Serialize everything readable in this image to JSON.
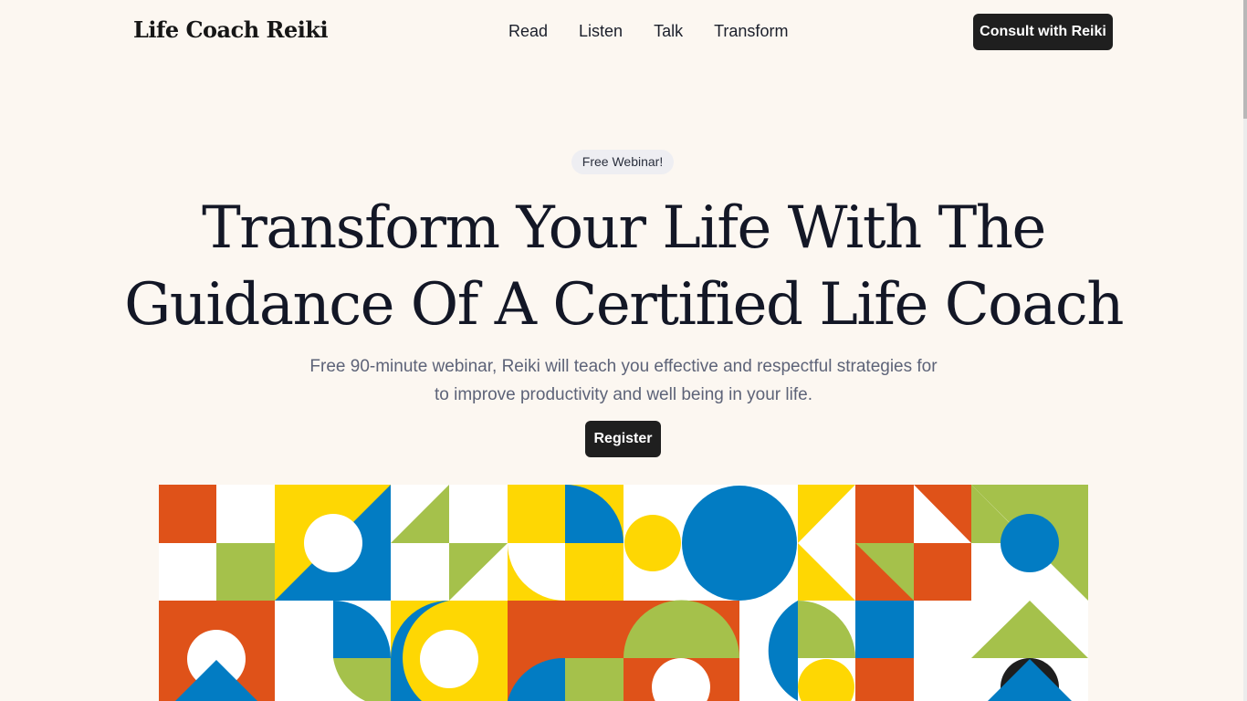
{
  "header": {
    "logo": "Life Coach Reiki",
    "nav": [
      "Read",
      "Listen",
      "Talk",
      "Transform"
    ],
    "cta_label": "Consult with Reiki"
  },
  "hero": {
    "badge": "Free Webinar!",
    "title_line1": "Transform Your Life With The",
    "title_line2": "Guidance Of A Certified Life Coach",
    "subtitle_line1": "Free 90-minute webinar, Reiki will teach you effective and respectful strategies for",
    "subtitle_line2": "to improve productivity and well being in your life.",
    "register_label": "Register"
  },
  "colors": {
    "background": "#fcf7f1",
    "button": "#1f1f1f",
    "orange": "#df5219",
    "yellow": "#fed703",
    "blue": "#027cc3",
    "green": "#a5c14b",
    "black": "#1e1e1e",
    "white": "#ffffff"
  },
  "illustration": {
    "name": "geometric-pattern-banner"
  }
}
